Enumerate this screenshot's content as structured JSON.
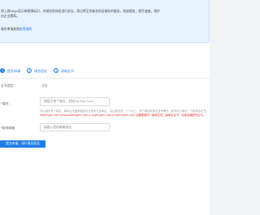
{
  "notice": {
    "line1": "将上网https显示带保障标识，对域名所有权进行验证，再过将至多级名的证域名的服务，快速颁发，提升速度，保护",
    "line2": "办企业提高。",
    "line3_prefix": "域名审请查阅",
    "line3_link": "使用指南"
  },
  "steps": [
    {
      "num": "1",
      "label": "提交申请"
    },
    {
      "num": "2",
      "label": "域名验证"
    },
    {
      "num": "3",
      "label": "获取证书"
    }
  ],
  "form": {
    "type_label": "证书类型：",
    "type_value": "非多",
    "domain_label": "*域名：",
    "domain_placeholder": "请填写单个域名，例如Ok.Pon.Com",
    "domain_hint_gray": "可以填写多个域名，填写后不能再修改并计算为付费单位，请认真检查。一个以上，多个域名用英文逗号隔开，最多可以填写一个新域名证书。",
    "domain_hint_red": "adjetugen.com,www.adjetugen.com,a.adjetugen.com,b.adjetugen.com 如果需要同一级域名的二级域名证书，请使用通配符证书。",
    "email_label": "*联系邮箱：",
    "email_placeholder": "请输入您的邮箱地址",
    "submit_label": "提交申请，进行域名验证"
  },
  "colors": {
    "accent": "#1e7de6",
    "notice_bg": "#e6f2fd",
    "hint_red": "#e4393c"
  }
}
